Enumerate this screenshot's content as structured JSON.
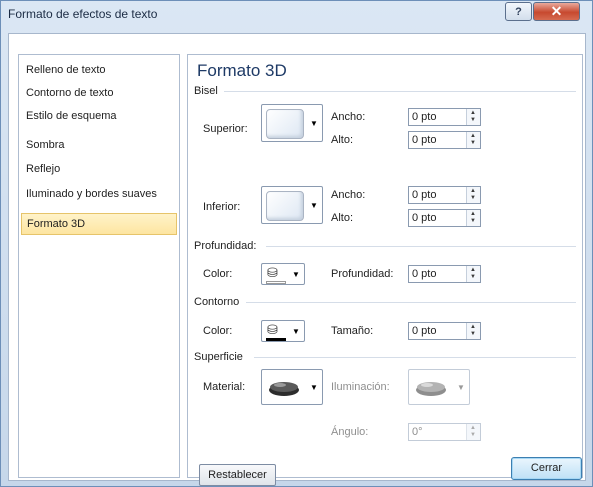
{
  "window": {
    "title": "Formato de efectos de texto",
    "help_label": "?",
    "close_label": "✕"
  },
  "sidebar": {
    "items": [
      {
        "label": "Relleno de texto",
        "selected": false
      },
      {
        "label": "Contorno de texto",
        "selected": false
      },
      {
        "label": "Estilo de esquema",
        "selected": false
      },
      {
        "label": "Sombra",
        "selected": false
      },
      {
        "label": "Reflejo",
        "selected": false
      },
      {
        "label": "Iluminado y bordes suaves",
        "selected": false
      },
      {
        "label": "Formato 3D",
        "selected": true
      }
    ]
  },
  "panel": {
    "heading": "Formato 3D",
    "bisel": {
      "section_label": "Bisel",
      "superior_label": "Superior:",
      "inferior_label": "Inferior:",
      "superior_ancho_label": "Ancho:",
      "superior_ancho_value": "0 pto",
      "superior_alto_label": "Alto:",
      "superior_alto_value": "0 pto",
      "inferior_ancho_label": "Ancho:",
      "inferior_ancho_value": "0 pto",
      "inferior_alto_label": "Alto:",
      "inferior_alto_value": "0 pto"
    },
    "profundidad": {
      "section_label": "Profundidad:",
      "color_label": "Color:",
      "profundidad_label": "Profundidad:",
      "profundidad_value": "0 pto",
      "swatch_color": "#ffffff"
    },
    "contorno": {
      "section_label": "Contorno",
      "color_label": "Color:",
      "tamano_label": "Tamaño:",
      "tamano_value": "0 pto",
      "swatch_color": "#000000"
    },
    "superficie": {
      "section_label": "Superficie",
      "material_label": "Material:",
      "iluminacion_label": "Iluminación:",
      "angulo_label": "Ángulo:",
      "angulo_value": "0°"
    },
    "reset_label": "Restablecer"
  },
  "footer": {
    "close_label": "Cerrar"
  },
  "colors": {
    "accent": "#1e3a66",
    "selected_bg": "#fde5a1",
    "close_red": "#c7492f"
  }
}
